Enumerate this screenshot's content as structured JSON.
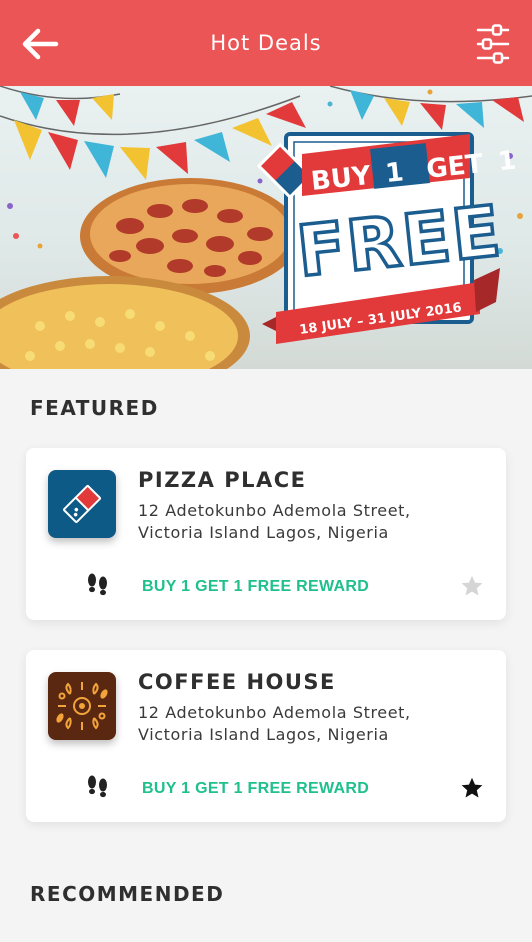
{
  "header": {
    "title": "Hot Deals",
    "back_icon": "arrow-left-icon",
    "filter_icon": "sliders-icon",
    "background_color": "#ec5556"
  },
  "banner": {
    "line1_prefix": "BUY",
    "line1_num1": "1",
    "line1_get": "GET",
    "line1_num2": "1",
    "big_word": "FREE",
    "dates": "18 JULY – 31 JULY 2016"
  },
  "featured": {
    "title": "FEATURED",
    "items": [
      {
        "name": "PIZZA PLACE",
        "address": "12 Adetokunbo Ademola Street, Victoria Island Lagos, Nigeria",
        "reward": "BUY 1 GET 1 FREE REWARD",
        "logo_icon": "domino-logo-icon",
        "favorited": false
      },
      {
        "name": "COFFEE HOUSE",
        "address": "12 Adetokunbo Ademola Street, Victoria Island Lagos, Nigeria",
        "reward": "BUY 1 GET 1 FREE REWARD",
        "logo_icon": "coffee-floral-logo-icon",
        "favorited": true
      }
    ]
  },
  "recommended": {
    "title": "RECOMMENDED"
  },
  "colors": {
    "accent": "#ec5556",
    "reward_green": "#1fc08c",
    "star_inactive": "#d5d5d5",
    "star_active": "#111111"
  }
}
